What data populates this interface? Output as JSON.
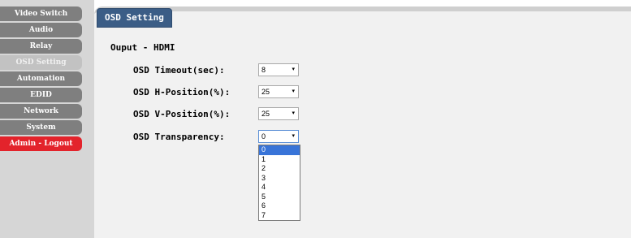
{
  "sidebar": {
    "items": [
      {
        "label": "Video Switch"
      },
      {
        "label": "Audio"
      },
      {
        "label": "Relay"
      },
      {
        "label": "OSD Setting"
      },
      {
        "label": "Automation"
      },
      {
        "label": "EDID"
      },
      {
        "label": "Network"
      },
      {
        "label": "System"
      },
      {
        "label": "Admin - Logout"
      }
    ]
  },
  "panel": {
    "title": "OSD Setting",
    "output_label": "Ouput - HDMI",
    "settings": [
      {
        "label": "OSD Timeout(sec):",
        "value": "8"
      },
      {
        "label": "OSD H-Position(%):",
        "value": "25"
      },
      {
        "label": "OSD V-Position(%):",
        "value": "25"
      },
      {
        "label": "OSD Transparency:",
        "value": "0"
      }
    ],
    "transparency_options": [
      "0",
      "1",
      "2",
      "3",
      "4",
      "5",
      "6",
      "7"
    ]
  },
  "colors": {
    "nav_bg": "#7f7f7f",
    "nav_active": "#c2c2c2",
    "logout": "#e3232b",
    "tab_title": "#3b5d86",
    "dropdown_highlight": "#3874d8"
  },
  "icons": {
    "select_caret": "▾"
  }
}
